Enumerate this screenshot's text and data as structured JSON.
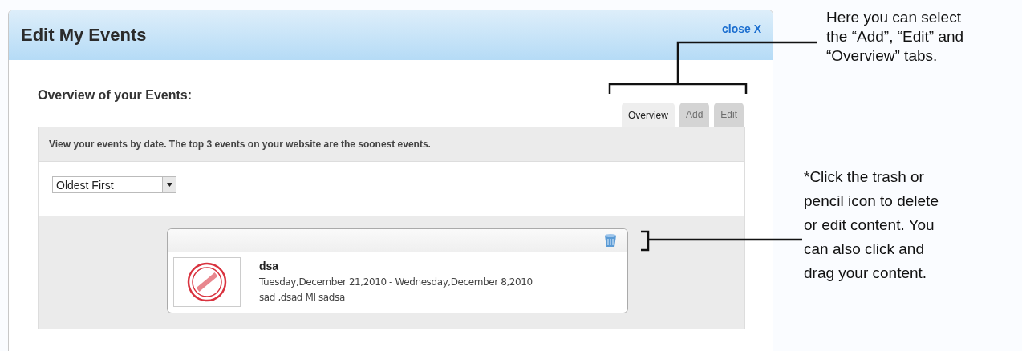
{
  "dialog": {
    "title": "Edit My Events",
    "close": "close X",
    "heading": "Overview of your Events:",
    "tabs": [
      {
        "label": "Overview",
        "selected": true
      },
      {
        "label": "Add",
        "selected": false
      },
      {
        "label": "Edit",
        "selected": false
      }
    ],
    "info": "View your events by date. The top 3 events on your website are the soonest events.",
    "sort": {
      "value": "Oldest First"
    },
    "events": [
      {
        "title": "dsa",
        "dates": "Tuesday,December 21,2010 - Wednesday,December 8,2010",
        "location": "sad ,dsad MI sadsa"
      }
    ]
  },
  "annotations": [
    {
      "lines": [
        "Here you can select",
        "the “Add”, “Edit” and",
        "“Overview” tabs."
      ]
    },
    {
      "lines": [
        "*Click the trash or",
        "pencil icon to delete",
        "or edit content. You",
        "can also click and",
        "drag your content."
      ]
    }
  ]
}
